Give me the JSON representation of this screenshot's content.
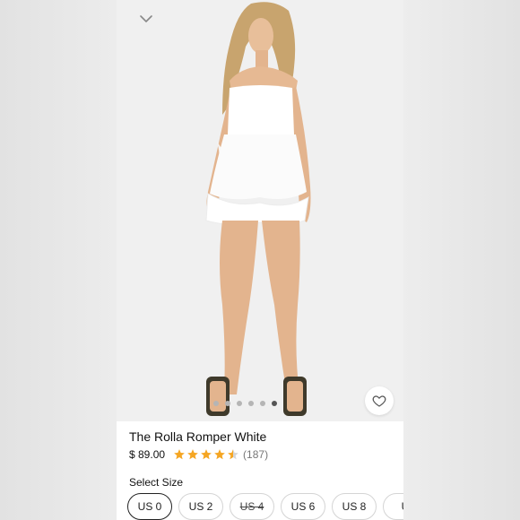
{
  "product": {
    "title": "The Rolla Romper White",
    "price": "$ 89.00",
    "rating": 4.5,
    "review_count": "(187)"
  },
  "gallery": {
    "image_count": 6,
    "active_index": 5
  },
  "size_selector": {
    "label": "Select Size",
    "options": [
      {
        "label": "US 0",
        "selected": true,
        "available": true
      },
      {
        "label": "US 2",
        "selected": false,
        "available": true
      },
      {
        "label": "US 4",
        "selected": false,
        "available": false
      },
      {
        "label": "US 6",
        "selected": false,
        "available": true
      },
      {
        "label": "US 8",
        "selected": false,
        "available": true
      },
      {
        "label": "U",
        "selected": false,
        "available": true
      }
    ]
  },
  "icons": {
    "back": "chevron-down-icon",
    "favorite": "heart-icon",
    "rating": "star-icon"
  },
  "colors": {
    "star": "#f5a623",
    "background": "#e9e9e9"
  }
}
